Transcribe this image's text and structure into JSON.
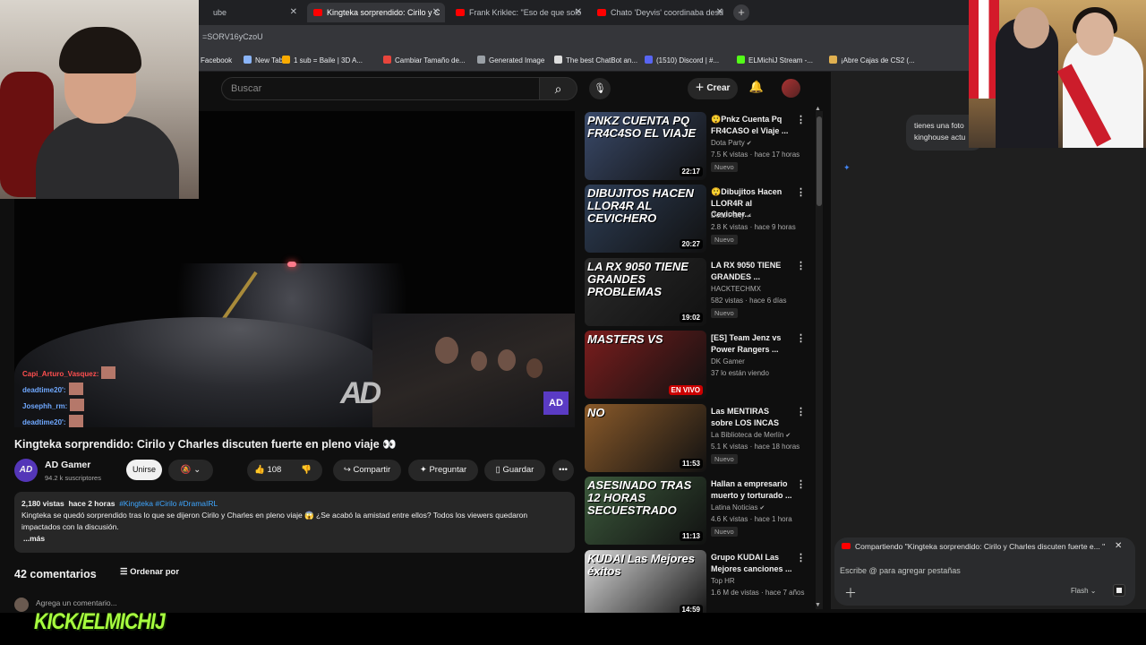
{
  "browser": {
    "tabs": [
      {
        "label": "ube",
        "active": false
      },
      {
        "label": "Kingteka sorprendido: Cirilo y C",
        "active": true
      },
      {
        "label": "Frank Kriklec: \"Eso de que solo",
        "active": false
      },
      {
        "label": "Chato 'Deyvis' coordinaba desd",
        "active": false
      }
    ],
    "new_tab": "+",
    "url": "=SORV16yCzoU",
    "bookmarks": [
      {
        "label": "Facebook",
        "color": "#1877f2"
      },
      {
        "label": "New Tab",
        "color": "#8ab4f8"
      },
      {
        "label": "1 sub = Baile | 3D A...",
        "color": "#f9ab00"
      },
      {
        "label": "Cambiar Tamaño de...",
        "color": "#e8453c"
      },
      {
        "label": "Generated Image",
        "color": "#9aa0a6"
      },
      {
        "label": "The best ChatBot an...",
        "color": "#dddddd"
      },
      {
        "label": "(1510) Discord | #...",
        "color": "#5865f2"
      },
      {
        "label": "ELMichiJ Stream -...",
        "color": "#53fc18"
      },
      {
        "label": "¡Abre Cajas de CS2 (...",
        "color": "#e0b050"
      }
    ]
  },
  "youtube_header": {
    "search_placeholder": "Buscar",
    "create_label": "Crear"
  },
  "video": {
    "title": "Kingteka sorprendido: Cirilo y Charles discuten fuerte en pleno viaje 👀",
    "watermark": "AD",
    "stream_chat": [
      {
        "user": "Capi_Arturo_Vasquez:",
        "color": "#ff4f4f"
      },
      {
        "user": "deadtime20':",
        "color": "#6fa8ff"
      },
      {
        "user": "Josephh_rm:",
        "color": "#6fa8ff"
      },
      {
        "user": "deadtime20':",
        "color": "#6fa8ff"
      }
    ],
    "channel": {
      "name": "AD Gamer",
      "subs": "94.2 k suscriptores",
      "avatar_text": "AD"
    },
    "join_label": "Unirse",
    "likes": "108",
    "share_label": "Compartir",
    "ask_label": "Preguntar",
    "save_label": "Guardar",
    "description": {
      "views": "2,180 vistas",
      "time": "hace 2 horas",
      "tags": "#Kingteka #Cirilo #DramaIRL",
      "text": "Kingteka se quedó sorprendido tras lo que se dijeron Cirilo y Charles en pleno viaje 😱 ¿Se acabó la amistad entre ellos? Todos los viewers quedaron impactados con la discusión.",
      "more": "...más"
    },
    "comments_count": "42 comentarios",
    "sort_label": "Ordenar por",
    "comment_placeholder": "Agrega un comentario..."
  },
  "overlay": {
    "kick_text": "KICK/ELMICHIJ"
  },
  "related": [
    {
      "title": "😲Pnkz Cuenta Pq FR4CASO el Viaje ...",
      "channel": "Dota Party",
      "verified": true,
      "meta": "7.5 K vistas · hace 17 horas",
      "badge": "Nuevo",
      "duration": "22:17",
      "thumb_text": "PNKZ CUENTA PQ FR4C4SO EL VIAJE",
      "thumb_color": "#3a4a6a"
    },
    {
      "title": "😲Dibujitos Hacen LLOR4R al Cevicher...",
      "channel": "Dota Party",
      "verified": true,
      "meta": "2.8 K vistas · hace 9 horas",
      "badge": "Nuevo",
      "duration": "20:27",
      "thumb_text": "DIBUJITOS HACEN LLOR4R AL CEVICHERO",
      "thumb_color": "#2d3d55"
    },
    {
      "title": "LA RX 9050 TIENE GRANDES ...",
      "channel": "HACKTECHMX",
      "verified": false,
      "meta": "582 vistas · hace 6 días",
      "badge": "Nuevo",
      "duration": "19:02",
      "thumb_text": "LA RX 9050 TIENE GRANDES PROBLEMAS",
      "thumb_color": "#2a2a2a"
    },
    {
      "title": "[ES] Team Jenz vs Power Rangers ...",
      "channel": "DK Gamer",
      "verified": false,
      "meta": "37 lo están viendo",
      "badge": "",
      "duration": "EN VIVO",
      "thumb_text": "MASTERS VS",
      "thumb_color": "#7a1d1d"
    },
    {
      "title": "Las MENTIRAS sobre LOS INCAS",
      "channel": "La Biblioteca de Merlín",
      "verified": true,
      "meta": "5.1 K vistas · hace 18 horas",
      "badge": "Nuevo",
      "duration": "11:53",
      "thumb_text": "NO",
      "thumb_color": "#8a5a2a"
    },
    {
      "title": "Hallan a empresario muerto y torturado ...",
      "channel": "Latina Noticias",
      "verified": true,
      "meta": "4.6 K vistas · hace 1 hora",
      "badge": "Nuevo",
      "duration": "11:13",
      "thumb_text": "ASESINADO TRAS 12 HORAS SECUESTRADO",
      "thumb_color": "#3c5a3c"
    },
    {
      "title": "Grupo KUDAI Las Mejores canciones ...",
      "channel": "Top HR",
      "verified": false,
      "meta": "1.6 M de vistas · hace 7 años",
      "badge": "",
      "duration": "14:59",
      "thumb_text": "KUDAI Las Mejores éxitos",
      "thumb_color": "#d8d8d8"
    }
  ],
  "side_panel": {
    "chat_bubble": "tienes una foto kinghouse actu",
    "sharing_text": "Compartiendo \"Kingteka sorprendido: Cirilo y Charles discuten fuerte e... \"",
    "input_placeholder": "Escribe @ para agregar pestañas",
    "model_label": "Flash"
  }
}
